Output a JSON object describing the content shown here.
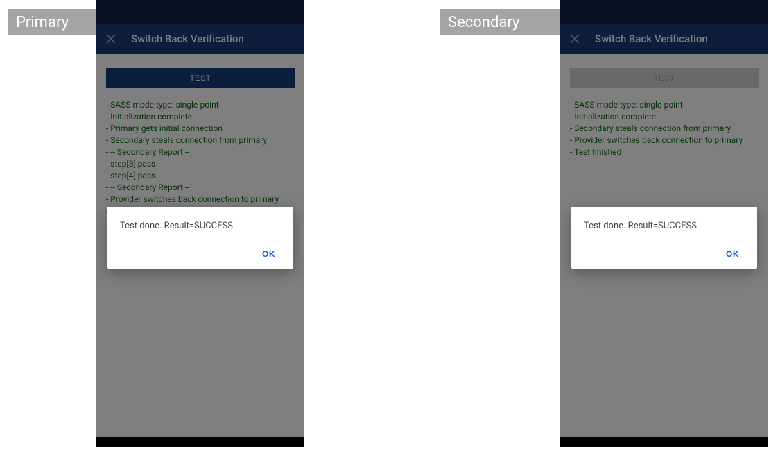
{
  "tags": {
    "primary": "Primary",
    "secondary": "Secondary"
  },
  "appbar": {
    "title": "Switch Back Verification"
  },
  "test_button": {
    "label": "TEST"
  },
  "primary_log": [
    "SASS mode type: single-point",
    "Initialization complete",
    "Primary gets initial connection",
    "Secondary steals connection from primary",
    "-- Secondary Report --",
    "step[3] pass",
    "step[4] pass",
    "-- Secondary Report --",
    "Provider switches back connection to primary",
    "Test finished"
  ],
  "secondary_log": [
    "SASS mode type: single-point",
    "Initialization complete",
    "Secondary steals connection from primary",
    "Provider switches back connection to primary",
    "Test finished"
  ],
  "dialog": {
    "message": "Test done. Result=SUCCESS",
    "ok": "OK"
  }
}
